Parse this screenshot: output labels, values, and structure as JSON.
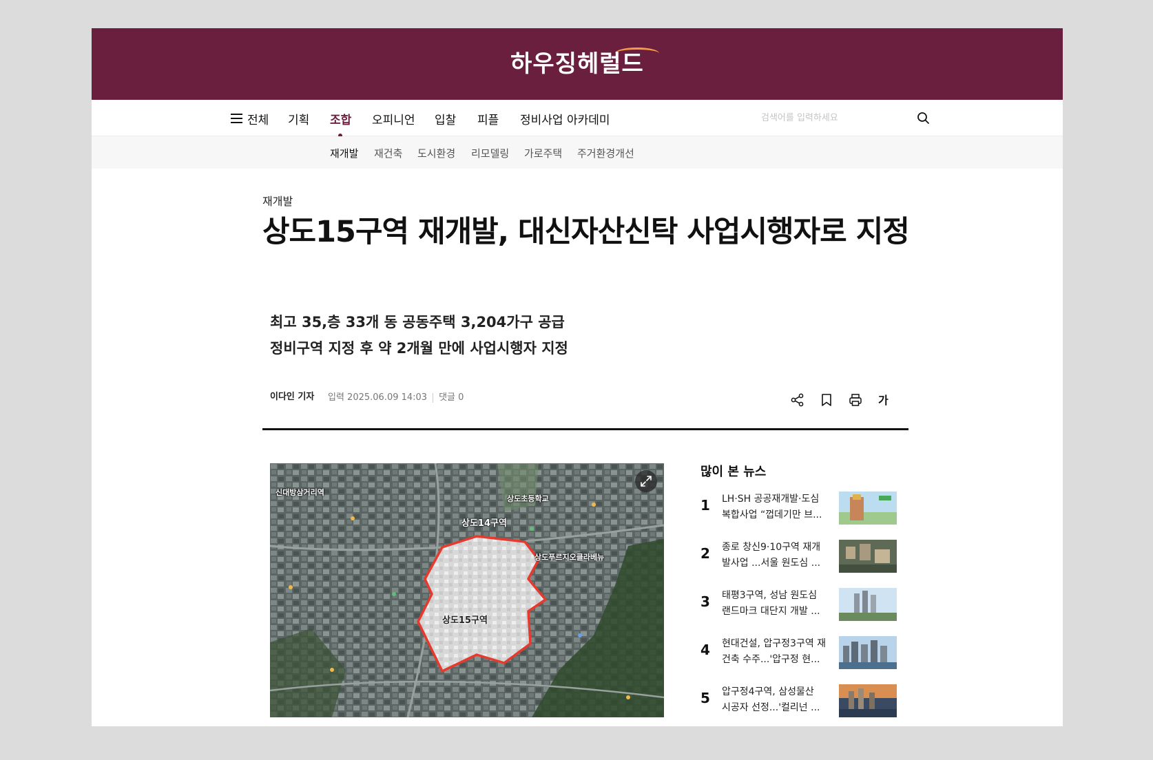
{
  "site": {
    "logo_text": "하우징헤럴드"
  },
  "gnb": {
    "all_label": "전체",
    "items": [
      "기획",
      "조합",
      "오피니언",
      "입찰",
      "피플",
      "정비사업 아카데미"
    ],
    "active": "조합",
    "search_placeholder": "검색어를 입력하세요"
  },
  "subnav": {
    "items": [
      "재개발",
      "재건축",
      "도시환경",
      "리모델링",
      "가로주택",
      "주거환경개선"
    ],
    "active": "재개발"
  },
  "article": {
    "category": "재개발",
    "title": "상도15구역 재개발, 대신자산신탁 사업시행자로 지정",
    "subtitle_lines": [
      "최고 35,층 33개 동 공동주택 3,204가구 공급",
      "정비구역 지정 후 약 2개월 만에 사업시행자 지정"
    ],
    "reporter": "이다인 기자",
    "date_label": "입력 2025.06.09 14:03",
    "comments_label": "댓글 0",
    "tools": {
      "font_label": "가"
    }
  },
  "map": {
    "labels": {
      "station": "신대방삼거리역",
      "school": "상도초등학교",
      "area14": "상도14구역",
      "school2": "상도푸르지오클라베뉴",
      "area15": "상도15구역"
    }
  },
  "most_viewed": {
    "title": "많이 본 뉴스",
    "items": [
      {
        "rank": "1",
        "line1": "LH·SH 공공재개발·도심",
        "line2": "복합사업 “껍데기만 브..."
      },
      {
        "rank": "2",
        "line1": "종로 창신9·10구역 재개",
        "line2": "발사업 ...서울 원도심 ..."
      },
      {
        "rank": "3",
        "line1": "태평3구역, 성남 원도심",
        "line2": "랜드마크 대단지 개발 ..."
      },
      {
        "rank": "4",
        "line1": "현대건설, 압구정3구역 재",
        "line2": "건축 수주...'압구정 현..."
      },
      {
        "rank": "5",
        "line1": "압구정4구역, 삼성물산",
        "line2": "시공자 선정...'컬리넌 ..."
      }
    ]
  },
  "colors": {
    "brand": "#6a1f3e",
    "accent_arc": "#f29b4a",
    "boundary": "#e63a2e"
  }
}
